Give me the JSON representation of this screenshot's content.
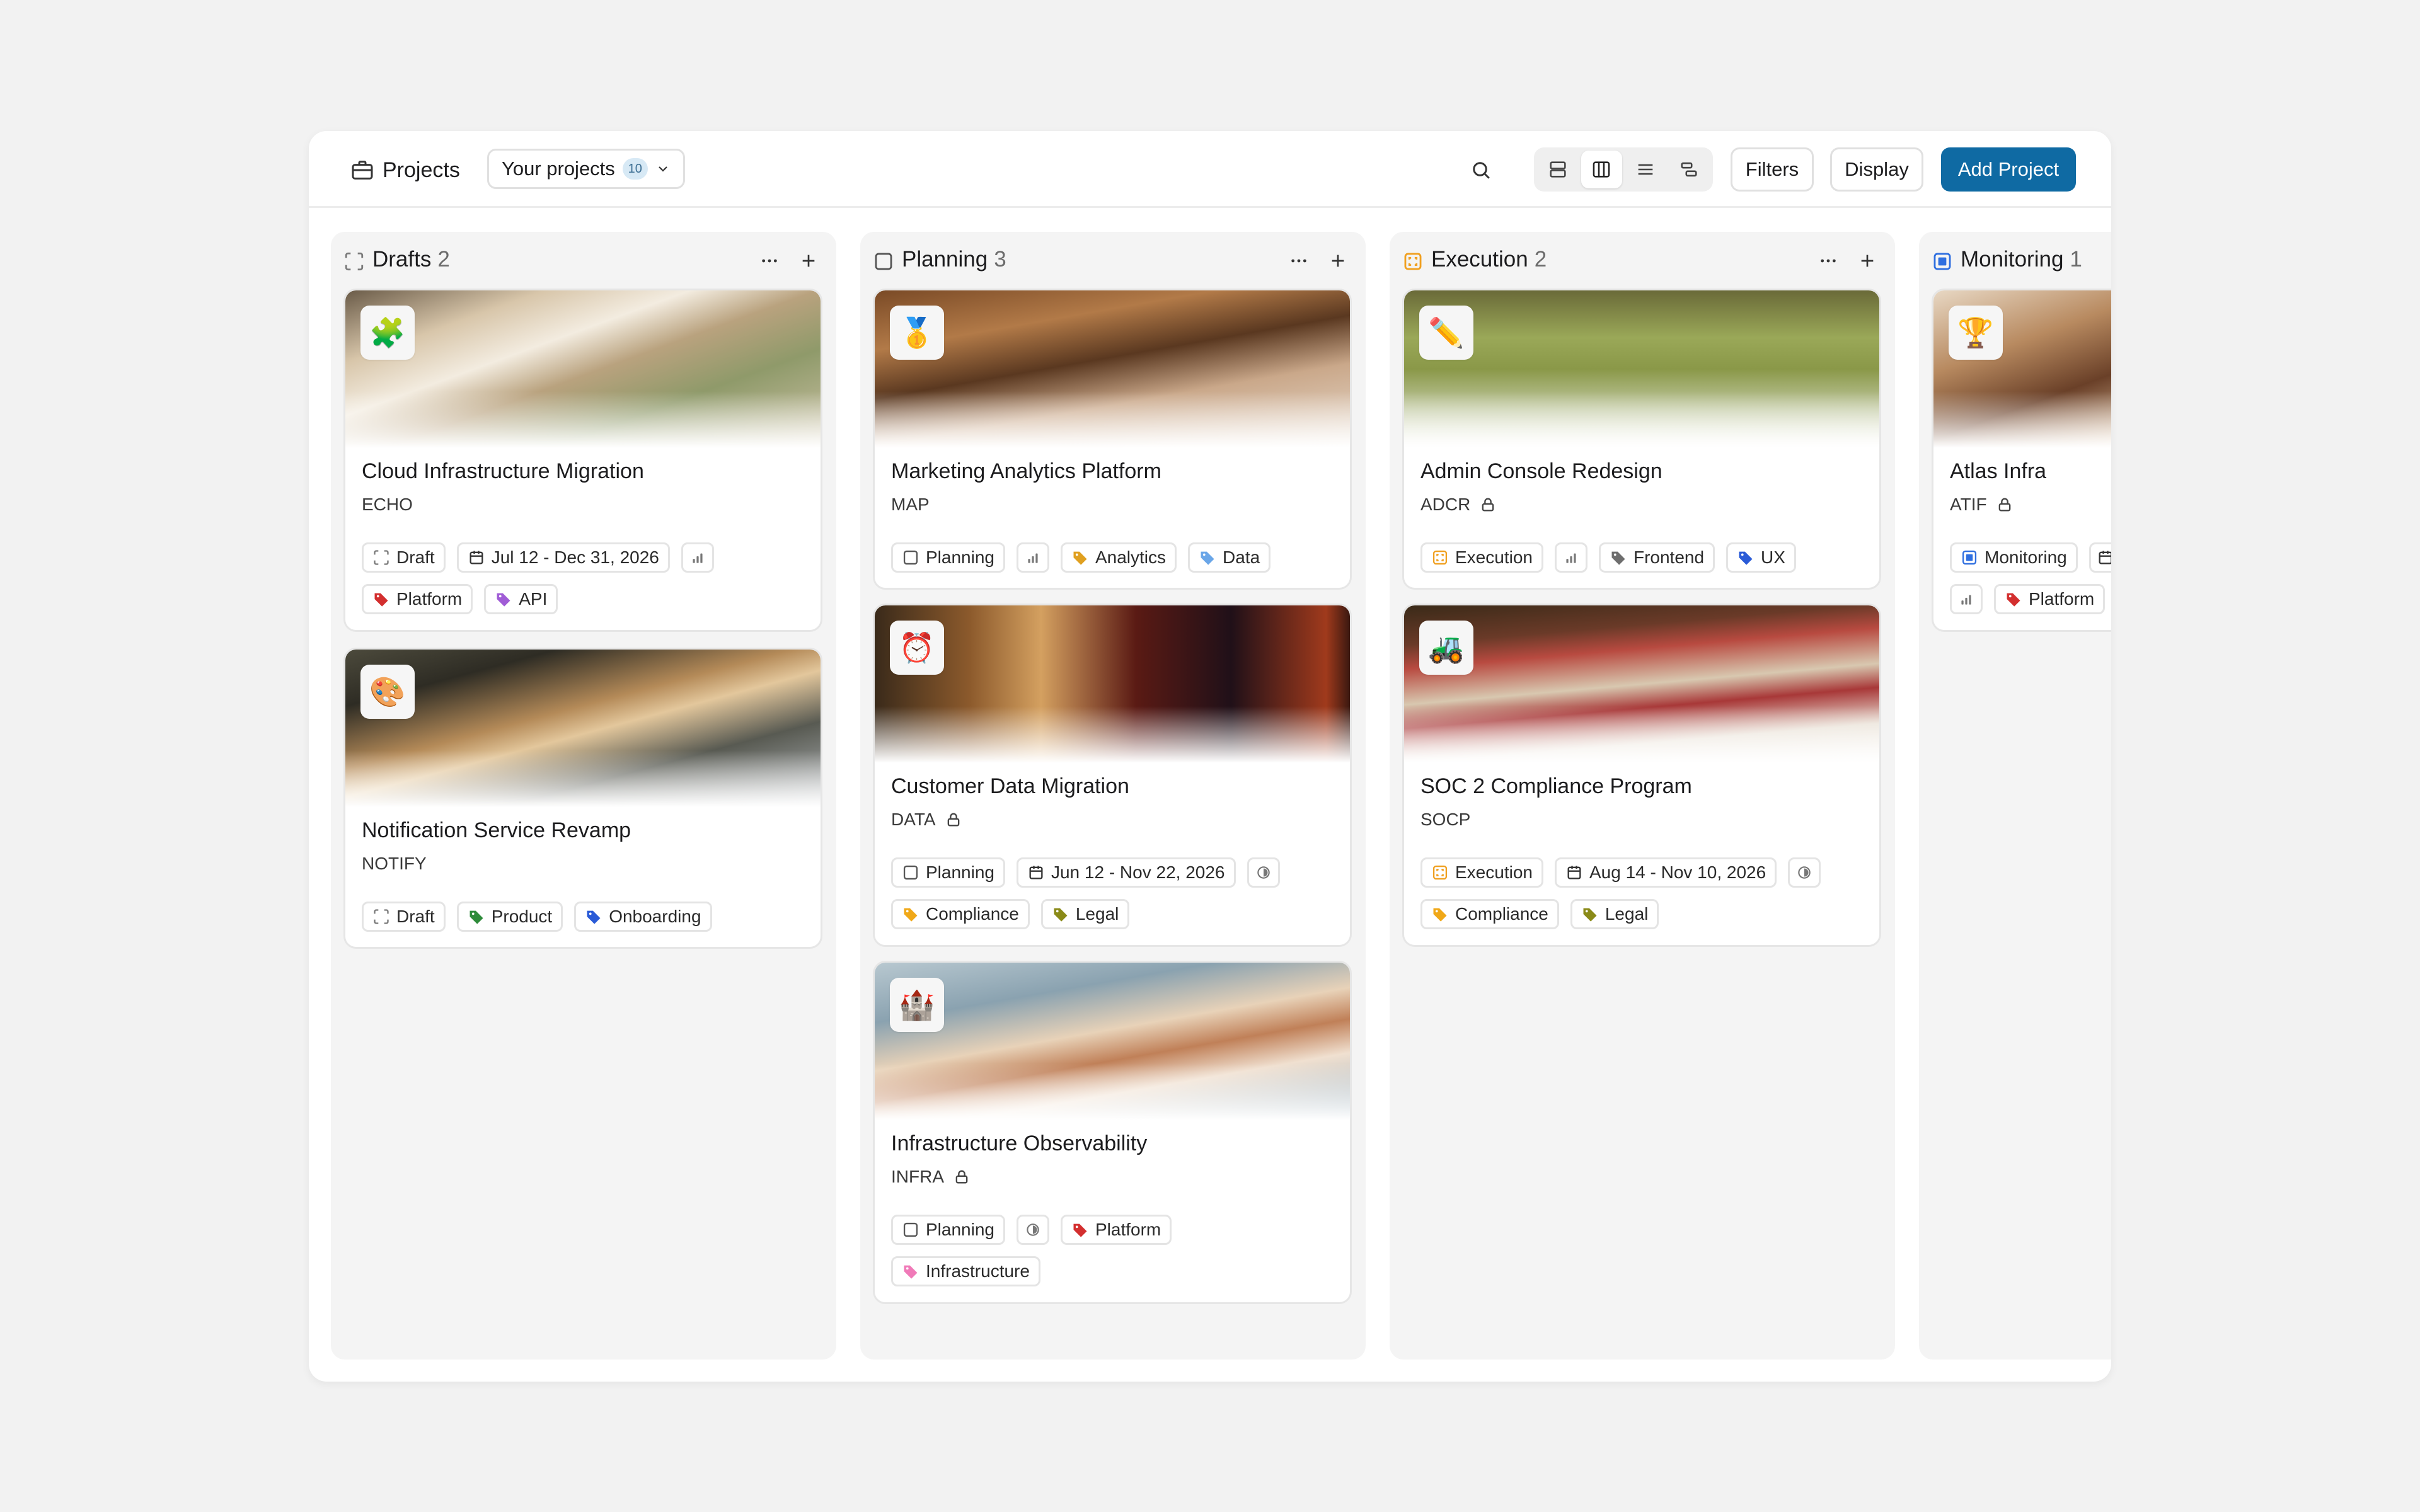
{
  "header": {
    "title": "Projects",
    "selector_label": "Your projects",
    "selector_count": "10",
    "filters_label": "Filters",
    "display_label": "Display",
    "add_label": "Add Project"
  },
  "colors": {
    "accent": "#0f6aa3",
    "draft": "#7a7a7a",
    "planning": "#555555",
    "execution": "#f0a020",
    "monitoring": "#2f6fe0"
  },
  "columns": [
    {
      "title": "Drafts",
      "count": "2",
      "cards": [
        {
          "title": "Cloud Infrastructure Migration",
          "key": "ECHO",
          "emoji": "🧩",
          "status": "Draft",
          "dates": "Jul 12 - Dec 31, 2026",
          "tags": [
            "Platform",
            "API"
          ]
        },
        {
          "title": "Notification Service Revamp",
          "key": "NOTIFY",
          "emoji": "🎨",
          "status": "Draft",
          "tags": [
            "Product",
            "Onboarding"
          ]
        }
      ]
    },
    {
      "title": "Planning",
      "count": "3",
      "cards": [
        {
          "title": "Marketing Analytics Platform",
          "key": "MAP",
          "emoji": "🥇",
          "status": "Planning",
          "tags": [
            "Analytics",
            "Data"
          ]
        },
        {
          "title": "Customer Data Migration",
          "key": "DATA",
          "emoji": "⏰",
          "status": "Planning",
          "dates": "Jun 12 - Nov 22, 2026",
          "tags": [
            "Compliance",
            "Legal"
          ]
        },
        {
          "title": "Infrastructure Observability",
          "key": "INFRA",
          "emoji": "🏰",
          "status": "Planning",
          "tags": [
            "Platform",
            "Infrastructure"
          ]
        }
      ]
    },
    {
      "title": "Execution",
      "count": "2",
      "cards": [
        {
          "title": "Admin Console Redesign",
          "key": "ADCR",
          "emoji": "✏️",
          "status": "Execution",
          "tags": [
            "Frontend",
            "UX"
          ]
        },
        {
          "title": "SOC 2 Compliance Program",
          "key": "SOCP",
          "emoji": "🚜",
          "status": "Execution",
          "dates": "Aug 14 - Nov 10, 2026",
          "tags": [
            "Compliance",
            "Legal"
          ]
        }
      ]
    },
    {
      "title": "Monitoring",
      "count": "1",
      "cards": [
        {
          "title": "Atlas Infra",
          "key": "ATIF",
          "emoji": "🏆",
          "status": "Monitoring",
          "tags": [
            "Platform"
          ]
        }
      ]
    }
  ]
}
